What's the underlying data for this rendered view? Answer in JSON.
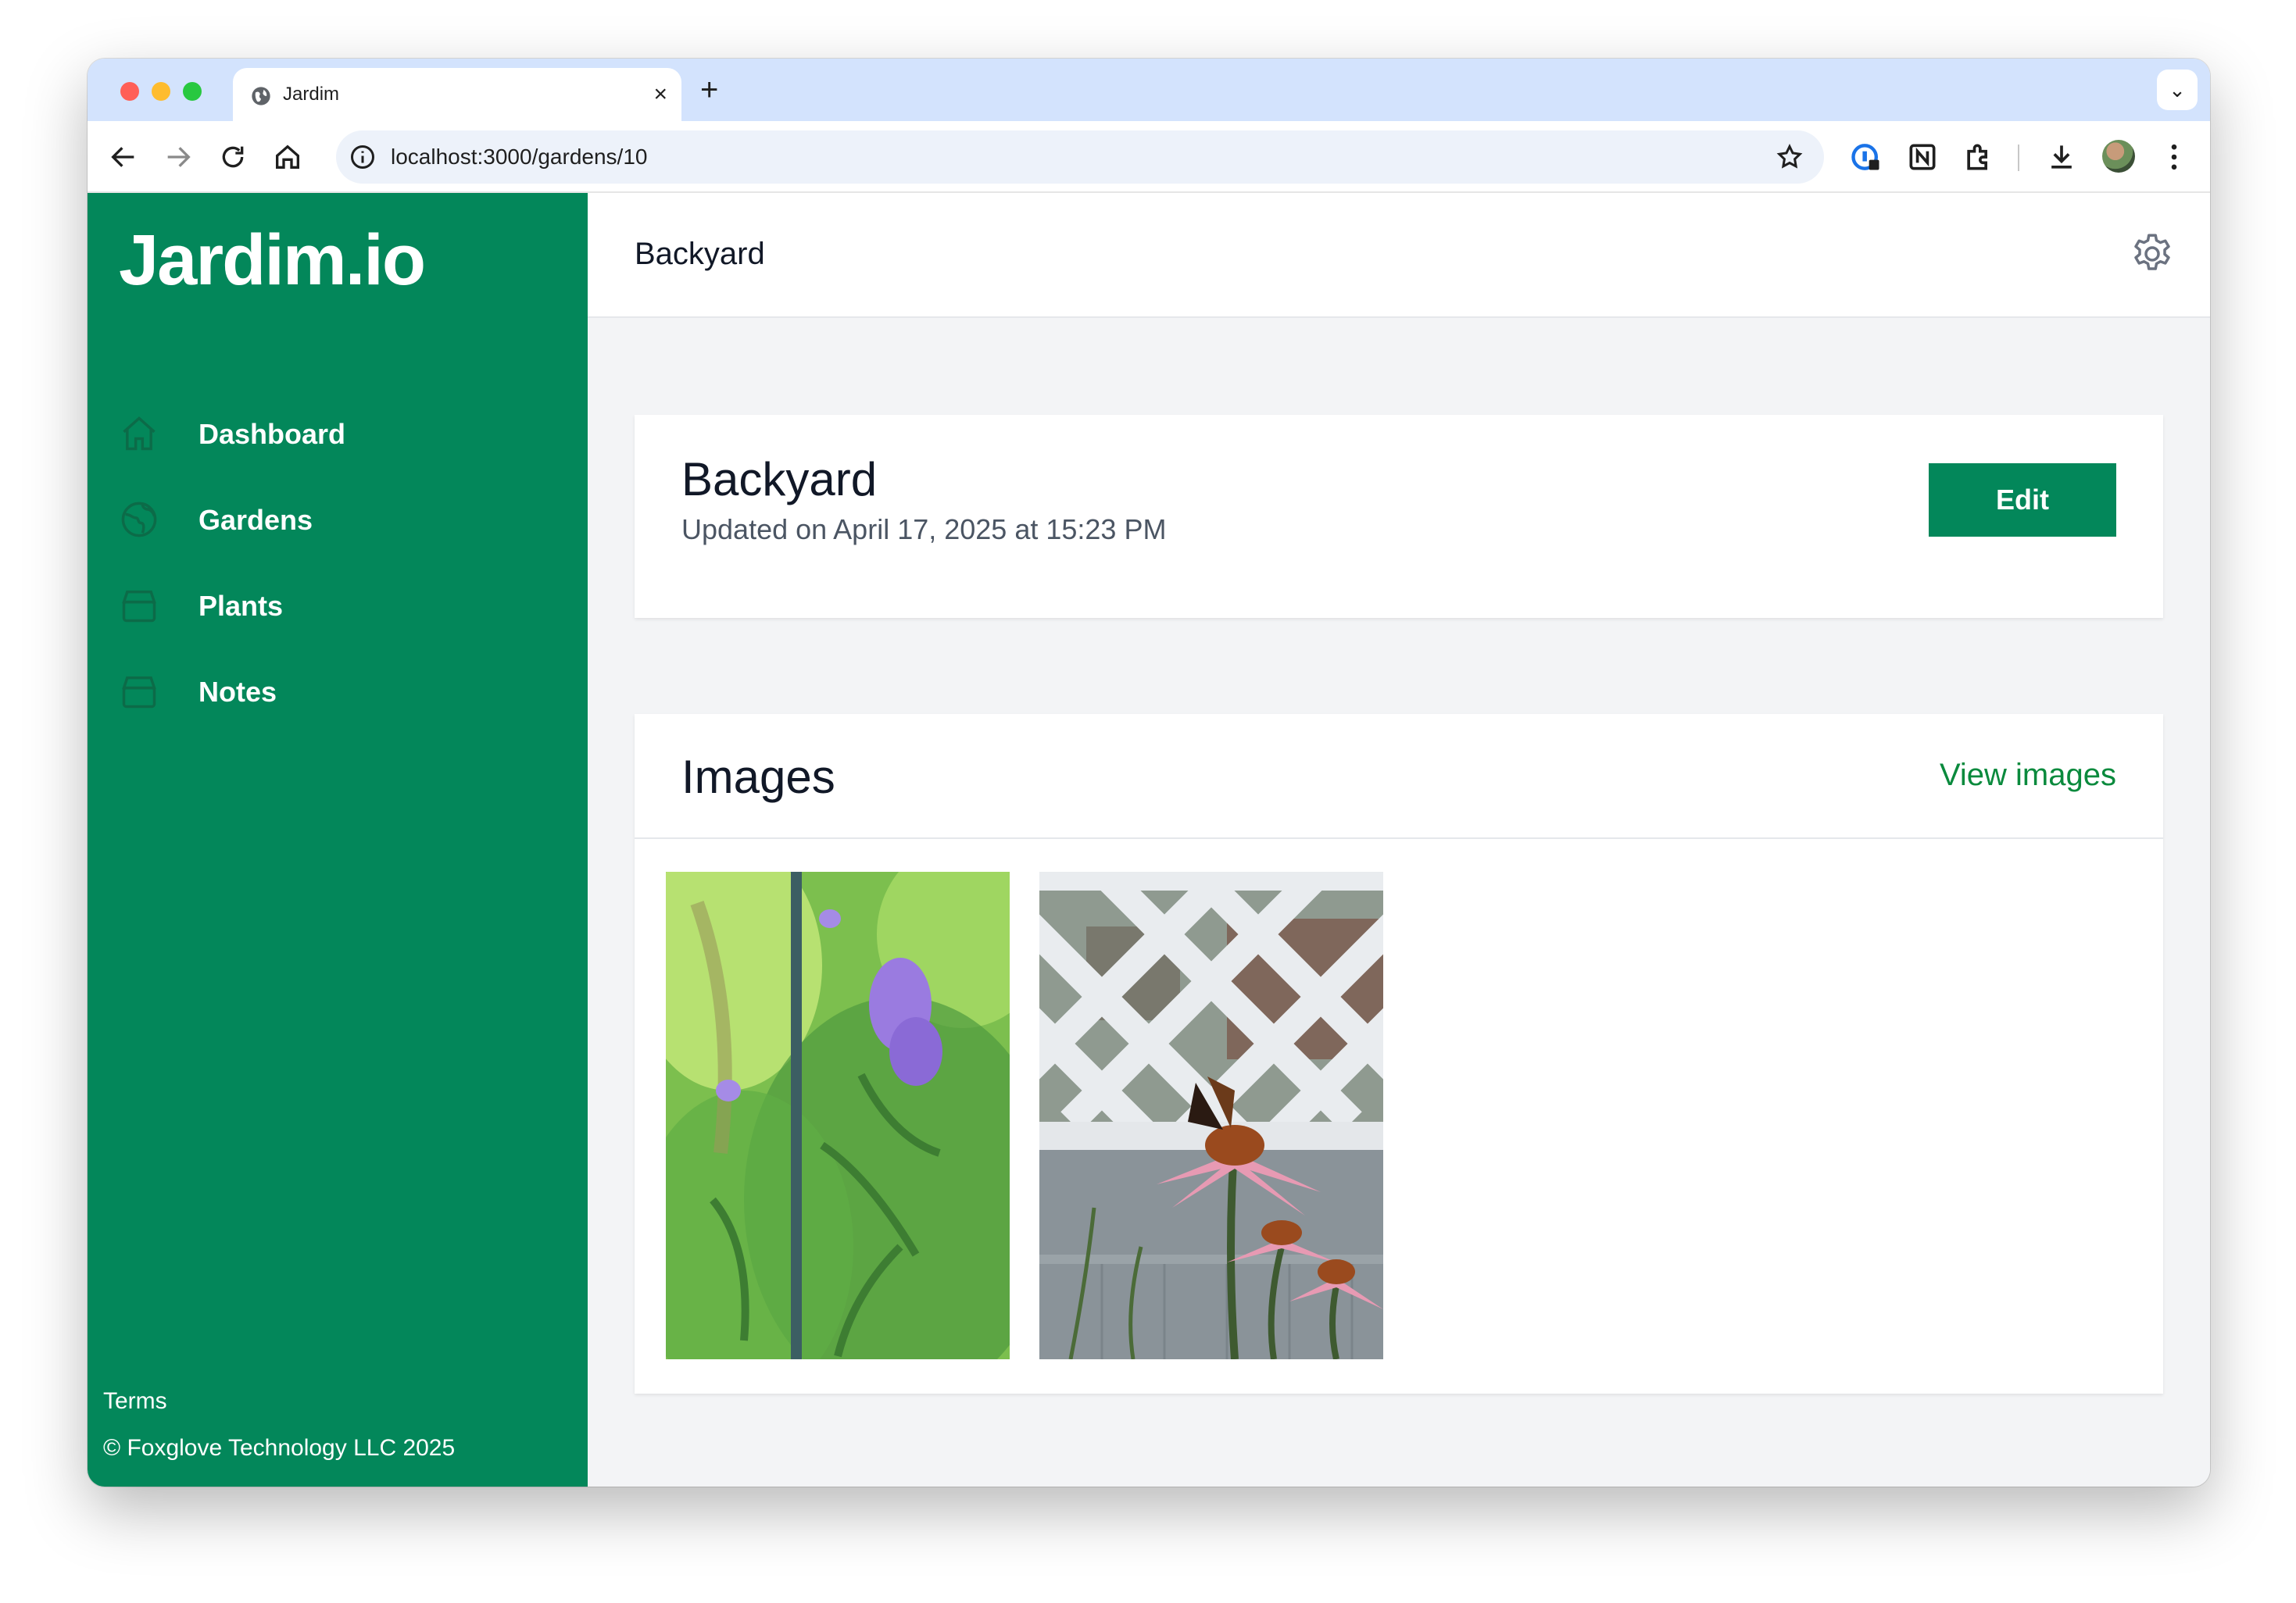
{
  "browser": {
    "tab_title": "Jardim",
    "tab_close": "×",
    "new_tab": "+",
    "tab_menu": "⌄",
    "url": "localhost:3000/gardens/10"
  },
  "sidebar": {
    "brand": "Jardim.io",
    "items": [
      {
        "label": "Dashboard",
        "icon": "home-icon"
      },
      {
        "label": "Gardens",
        "icon": "globe-icon"
      },
      {
        "label": "Plants",
        "icon": "archive-icon"
      },
      {
        "label": "Notes",
        "icon": "archive-icon"
      }
    ],
    "terms": "Terms",
    "copyright": "© Foxglove Technology LLC 2025"
  },
  "header": {
    "title": "Backyard"
  },
  "garden": {
    "name": "Backyard",
    "updated": "Updated on April 17, 2025 at 15:23 PM",
    "edit_label": "Edit"
  },
  "images": {
    "title": "Images",
    "view_label": "View images"
  },
  "colors": {
    "brand_green": "#03875a",
    "link_green": "#0a8a3d"
  }
}
